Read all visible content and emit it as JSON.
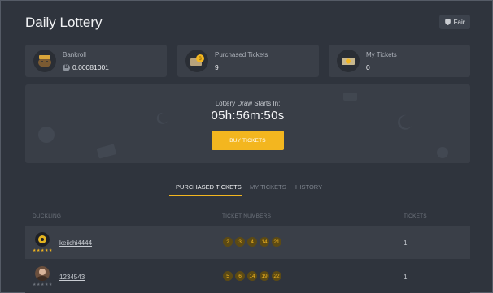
{
  "header": {
    "title": "Daily Lottery",
    "fair_label": "Fair"
  },
  "stats": [
    {
      "label": "Bankroll",
      "value": "0.00081001",
      "icon": "pig-icon"
    },
    {
      "label": "Purchased Tickets",
      "value": "9",
      "icon": "coin-ticket-icon"
    },
    {
      "label": "My Tickets",
      "value": "0",
      "icon": "ticket-icon"
    }
  ],
  "draw": {
    "label": "Lottery Draw Starts In:",
    "countdown": "05h:56m:50s",
    "buy_label": "BUY TICKETS"
  },
  "tabs": [
    {
      "label": "PURCHASED TICKETS",
      "active": true
    },
    {
      "label": "MY TICKETS",
      "active": false
    },
    {
      "label": "HISTORY",
      "active": false
    }
  ],
  "table": {
    "headers": {
      "user": "DUCKLING",
      "numbers": "TICKET NUMBERS",
      "tickets": "TICKETS"
    },
    "rows": [
      {
        "user": "keiichi4444",
        "numbers": [
          "2",
          "3",
          "4",
          "14",
          "21"
        ],
        "tickets": "1",
        "star_rating": 4
      },
      {
        "user": "1234543",
        "numbers": [
          "5",
          "6",
          "14",
          "19",
          "22"
        ],
        "tickets": "1",
        "star_rating": 0
      }
    ]
  },
  "colors": {
    "accent": "#f3b61f",
    "background": "#2f343d",
    "card": "#3a3f48"
  }
}
